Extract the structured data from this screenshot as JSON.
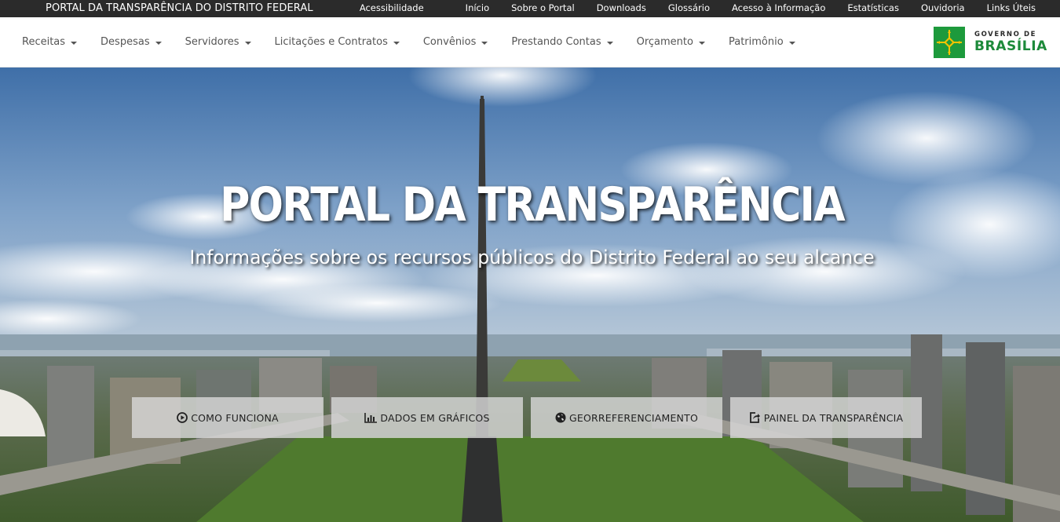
{
  "topbar": {
    "site_title": "PORTAL DA TRANSPARÊNCIA DO DISTRITO FEDERAL",
    "links": [
      "Acessibilidade",
      "Início",
      "Sobre o Portal",
      "Downloads",
      "Glossário",
      "Acesso à Informação",
      "Estatísticas",
      "Ouvidoria",
      "Links Úteis"
    ]
  },
  "nav": {
    "items": [
      "Receitas",
      "Despesas",
      "Servidores",
      "Licitações e Contratos",
      "Convênios",
      "Prestando Contas",
      "Orçamento",
      "Patrimônio"
    ]
  },
  "logo": {
    "line1": "GOVERNO DE",
    "line2": "BRASÍLIA",
    "brand_color": "#1d9a3c"
  },
  "hero": {
    "title": "PORTAL DA TRANSPARÊNCIA",
    "subtitle": "Informações sobre os recursos públicos do Distrito Federal ao seu alcance"
  },
  "actions": [
    {
      "label": "COMO FUNCIONA",
      "icon": "play-circle-icon"
    },
    {
      "label": "DADOS EM GRÁFICOS",
      "icon": "bar-chart-icon"
    },
    {
      "label": "GEORREFERENCIAMENTO",
      "icon": "globe-icon"
    },
    {
      "label": "PAINEL DA TRANSPARÊNCIA",
      "icon": "external-link-icon"
    }
  ]
}
